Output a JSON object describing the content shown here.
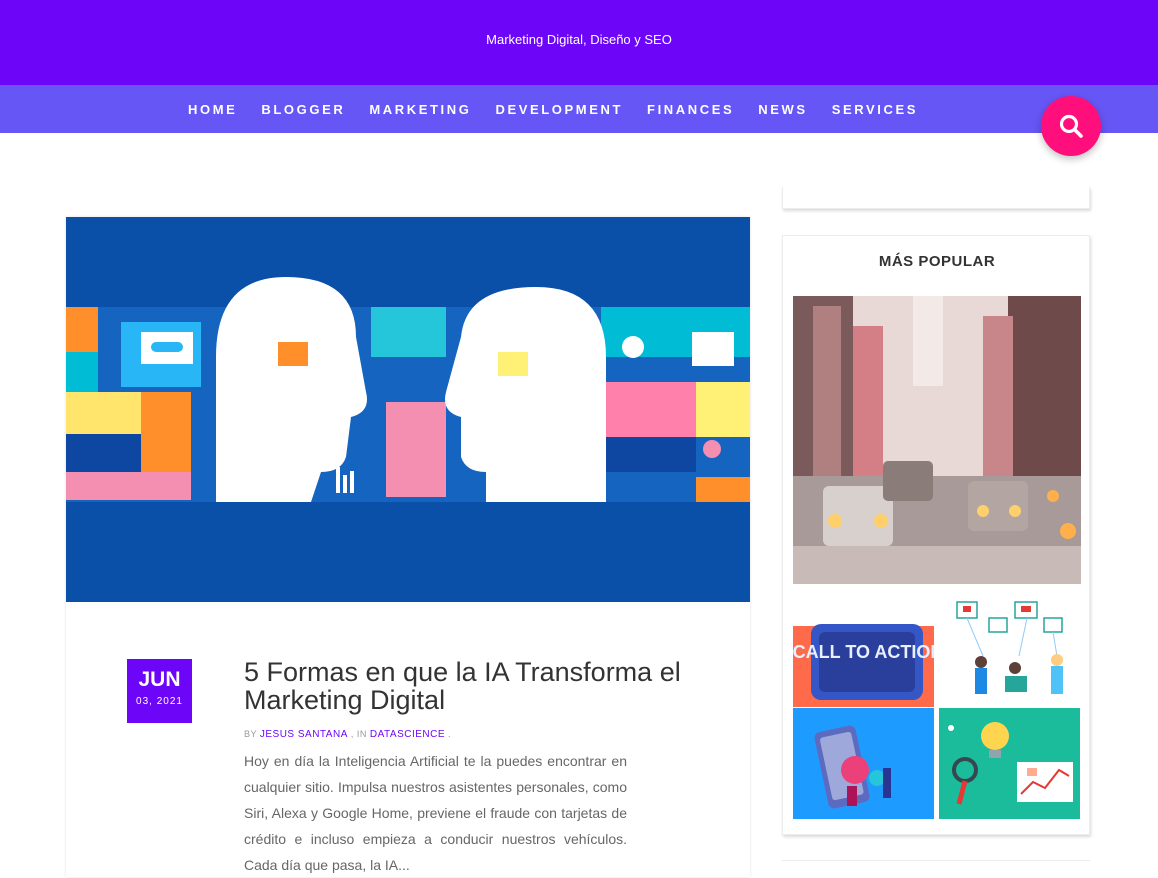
{
  "site": {
    "tagline": "Marketing Digital, Diseño y SEO"
  },
  "nav": {
    "items": [
      {
        "label": "HOME"
      },
      {
        "label": "BLOGGER"
      },
      {
        "label": "MARKETING"
      },
      {
        "label": "DEVELOPMENT"
      },
      {
        "label": "FINANCES"
      },
      {
        "label": "NEWS"
      },
      {
        "label": "SERVICES"
      }
    ]
  },
  "search": {
    "icon": "search-icon"
  },
  "post": {
    "date": {
      "month": "JUN",
      "day": "03, 2021"
    },
    "title": "5 Formas en que la IA Transforma el Marketing Digital",
    "meta": {
      "by": "BY",
      "author": "JESUS SANTANA",
      "in": "IN",
      "category": "DATASCIENCE"
    },
    "excerpt": "Hoy en día la Inteligencia Artificial te la puedes encontrar en cualquier sitio. Impulsa nuestros asistentes personales, como Siri, Alexa y Google Home, previene el fraude con tarjetas de crédito e incluso empieza a conducir nuestros vehículos. Cada día que pasa, la IA..."
  },
  "sidebar": {
    "popular": {
      "title": "MÁS POPULAR",
      "small_items": [
        {
          "image_text": "CALL TO ACTION"
        }
      ]
    }
  },
  "colors": {
    "header": "#6d06f9",
    "nav": "#6656f5",
    "search_button": "#ff0f7b",
    "accent": "#6d06f9"
  }
}
